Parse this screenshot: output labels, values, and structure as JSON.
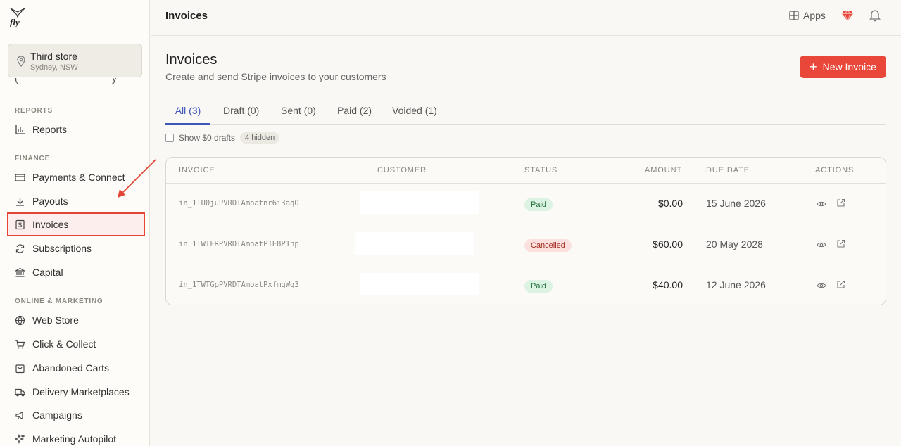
{
  "sidebar": {
    "store": {
      "name": "Third store",
      "location": "Sydney, NSW"
    },
    "sections": {
      "reports": "REPORTS",
      "finance": "FINANCE",
      "online": "ONLINE & MARKETING"
    },
    "items": {
      "reports": "Reports",
      "payments": "Payments & Connect",
      "payouts": "Payouts",
      "invoices": "Invoices",
      "subscriptions": "Subscriptions",
      "capital": "Capital",
      "web_store": "Web Store",
      "click_collect": "Click & Collect",
      "abandoned_carts": "Abandoned Carts",
      "delivery": "Delivery Marketplaces",
      "campaigns": "Campaigns",
      "autopilot": "Marketing Autopilot"
    },
    "active_item": "invoices",
    "colors": {
      "active_border": "#e34536",
      "annotation_arrow": "#e34536"
    }
  },
  "header": {
    "title": "Invoices",
    "apps_label": "Apps"
  },
  "main": {
    "title": "Invoices",
    "subtitle": "Create and send Stripe invoices to your customers",
    "new_button": "New Invoice",
    "tabs": [
      "All (3)",
      "Draft (0)",
      "Sent (0)",
      "Paid (2)",
      "Voided (1)"
    ],
    "active_tab": 0,
    "show_drafts_label": "Show $0 drafts",
    "show_drafts_checked": false,
    "hidden_count": "4 hidden"
  },
  "table": {
    "columns": {
      "invoice": "INVOICE",
      "customer": "CUSTOMER",
      "status": "STATUS",
      "amount": "AMOUNT",
      "due_date": "DUE DATE",
      "actions": "ACTIONS"
    },
    "rows": [
      {
        "id": "in_1TU0juPVRDTAmoatnr6i3aqO",
        "status": "Paid",
        "amount": "$0.00",
        "due": "15 June 2026"
      },
      {
        "id": "in_1TWTFRPVRDTAmoatP1E8P1np",
        "status": "Cancelled",
        "amount": "$60.00",
        "due": "20 May 2028"
      },
      {
        "id": "in_1TWTGpPVRDTAmoatPxfmgWq3",
        "status": "Paid",
        "amount": "$40.00",
        "due": "12 June 2026"
      }
    ]
  },
  "colors": {
    "accent": "#e8473a",
    "tab_active": "#3f57b8",
    "paid_bg": "#dcf2e2",
    "cancelled_bg": "#fbe0dd"
  }
}
